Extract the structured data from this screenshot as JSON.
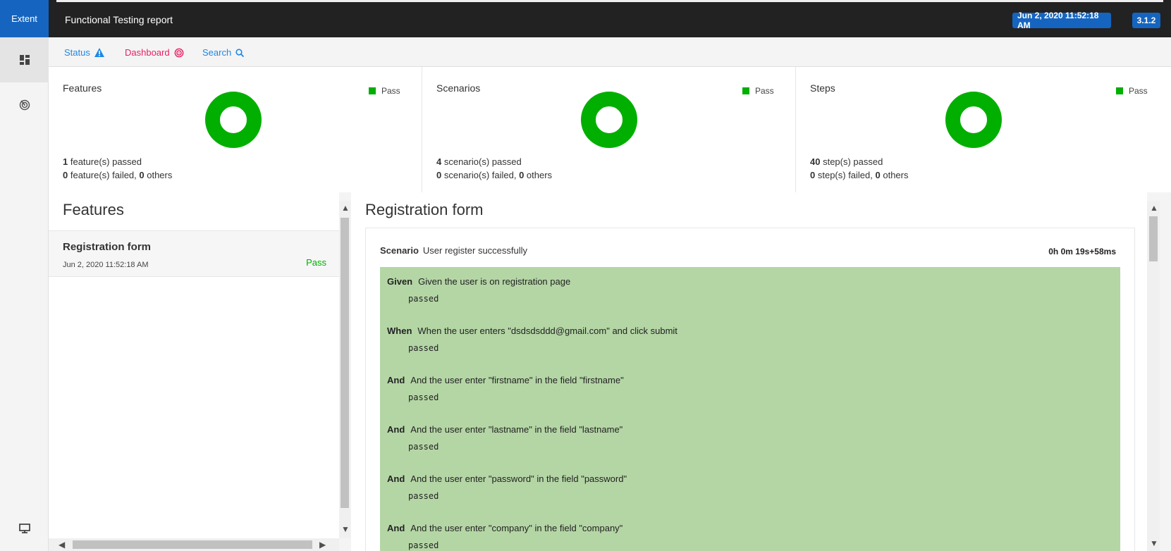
{
  "header": {
    "brand": "Extent",
    "report_name": "Functional Testing report",
    "date": "Jun 2, 2020 11:52:18 AM",
    "version": "3.1.2"
  },
  "nav": {
    "items": [
      {
        "icon": "dashboard-grid-icon"
      },
      {
        "icon": "radar-icon"
      }
    ],
    "bottom_icon": "monitor-icon"
  },
  "subnav": {
    "status": "Status",
    "dashboard": "Dashboard",
    "search": "Search"
  },
  "cards": [
    {
      "title": "Features",
      "legend": "Pass",
      "passed_count": "1",
      "passed_text": " feature(s) passed",
      "failed_count": "0",
      "failed_text": " feature(s) failed, ",
      "others_count": "0",
      "others_text": " others",
      "pass_fraction": 1.0
    },
    {
      "title": "Scenarios",
      "legend": "Pass",
      "passed_count": "4",
      "passed_text": " scenario(s) passed",
      "failed_count": "0",
      "failed_text": " scenario(s) failed, ",
      "others_count": "0",
      "others_text": " others",
      "pass_fraction": 1.0
    },
    {
      "title": "Steps",
      "legend": "Pass",
      "passed_count": "40",
      "passed_text": " step(s) passed",
      "failed_count": "0",
      "failed_text": " step(s) failed, ",
      "others_count": "0",
      "others_text": " others",
      "pass_fraction": 1.0
    }
  ],
  "colors": {
    "pass": "#00af00",
    "accent": "#1565c0",
    "dashboard": "#e91e63",
    "step_pass_bg": "#b4d6a5"
  },
  "features": {
    "heading": "Features",
    "items": [
      {
        "name": "Registration form",
        "date": "Jun 2, 2020 11:52:18 AM",
        "status": "Pass"
      }
    ]
  },
  "detail": {
    "title": "Registration form",
    "scenario": {
      "keyword": "Scenario",
      "name": "User register successfully",
      "duration": "0h 0m 19s+58ms",
      "steps": [
        {
          "keyword": "Given",
          "text": "Given the user is on registration page",
          "status": "passed"
        },
        {
          "keyword": "When",
          "text": "When the user enters \"dsdsdsddd@gmail.com\" and click submit",
          "status": "passed"
        },
        {
          "keyword": "And",
          "text": "And the user enter \"firstname\" in the field \"firstname\"",
          "status": "passed"
        },
        {
          "keyword": "And",
          "text": "And the user enter \"lastname\" in the field \"lastname\"",
          "status": "passed"
        },
        {
          "keyword": "And",
          "text": "And the user enter \"password\" in the field \"password\"",
          "status": "passed"
        },
        {
          "keyword": "And",
          "text": "And the user enter \"company\" in the field \"company\"",
          "status": "passed"
        }
      ]
    }
  }
}
